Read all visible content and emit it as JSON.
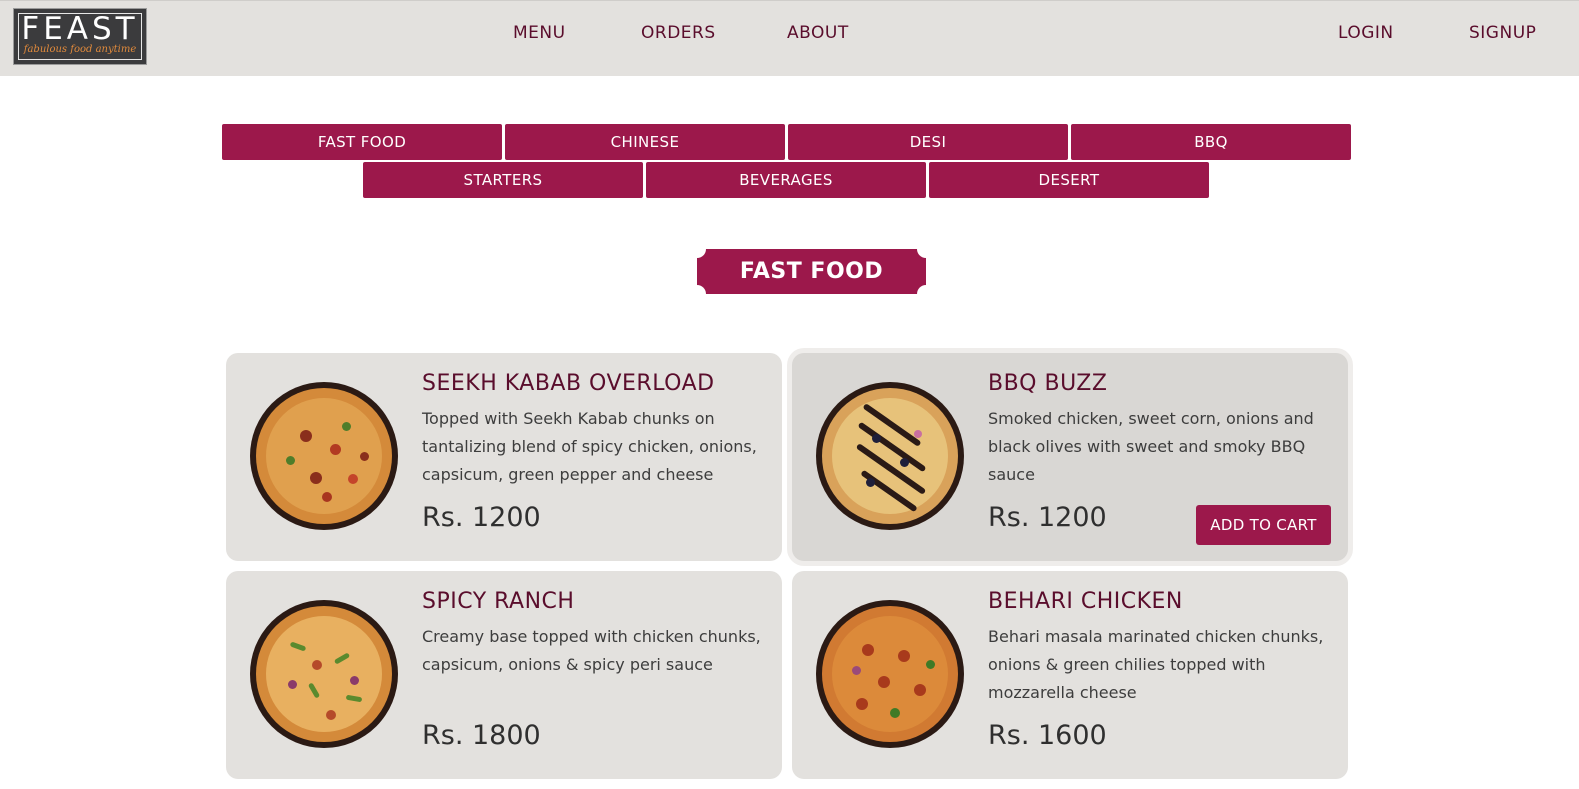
{
  "header": {
    "logo_word": "FEAST",
    "logo_tagline": "fabulous food anytime",
    "nav_center": [
      "MENU",
      "ORDERS",
      "ABOUT"
    ],
    "nav_right": [
      "LOGIN",
      "SIGNUP"
    ]
  },
  "categories": [
    "FAST FOOD",
    "CHINESE",
    "DESI",
    "BBQ",
    "STARTERS",
    "BEVERAGES",
    "DESERT"
  ],
  "section": {
    "title": "FAST FOOD"
  },
  "products": [
    {
      "name": "SEEKH KABAB OVERLOAD",
      "description": "Topped with Seekh Kabab chunks on tantalizing blend of spicy chicken, onions, capsicum, green pepper and cheese",
      "price": "Rs. 1200",
      "image": "pizza-seekh-kabab"
    },
    {
      "name": "BBQ BUZZ",
      "description": "Smoked chicken, sweet corn, onions and black olives with sweet and smoky BBQ sauce",
      "price": "Rs. 1200",
      "image": "pizza-bbq",
      "cart_label": "ADD TO CART"
    },
    {
      "name": "SPICY RANCH",
      "description": "Creamy base topped with chicken chunks, capsicum, onions & spicy peri sauce",
      "price": "Rs. 1800",
      "image": "pizza-spicy-ranch"
    },
    {
      "name": "BEHARI CHICKEN",
      "description": "Behari masala marinated chicken chunks, onions & green chilies topped with mozzarella cheese",
      "price": "Rs. 1600",
      "image": "pizza-behari"
    }
  ],
  "colors": {
    "brand": "#9c184b",
    "nav_text": "#5a0d2c",
    "card_bg": "#e3e1de",
    "header_bg": "#e3e1de"
  }
}
